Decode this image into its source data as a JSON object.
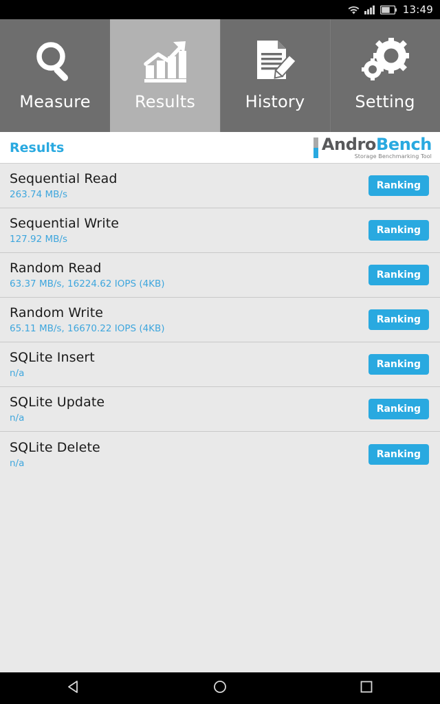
{
  "status_bar": {
    "time": "13:49",
    "icons": [
      "wifi-icon",
      "cellular-signal-icon",
      "battery-icon"
    ]
  },
  "tabs": [
    {
      "label": "Measure",
      "icon": "magnifier-icon",
      "active": false
    },
    {
      "label": "Results",
      "icon": "bar-chart-arrow-icon",
      "active": true
    },
    {
      "label": "History",
      "icon": "document-pencil-icon",
      "active": false
    },
    {
      "label": "Setting",
      "icon": "gears-icon",
      "active": false
    }
  ],
  "header": {
    "title": "Results",
    "logo_primary": "Andro",
    "logo_secondary": "Bench",
    "logo_tagline": "Storage Benchmarking Tool"
  },
  "results": [
    {
      "name": "Sequential Read",
      "value": "263.74 MB/s",
      "button": "Ranking"
    },
    {
      "name": "Sequential Write",
      "value": "127.92 MB/s",
      "button": "Ranking"
    },
    {
      "name": "Random Read",
      "value": "63.37 MB/s, 16224.62 IOPS (4KB)",
      "button": "Ranking"
    },
    {
      "name": "Random Write",
      "value": "65.11 MB/s, 16670.22 IOPS (4KB)",
      "button": "Ranking"
    },
    {
      "name": "SQLite Insert",
      "value": "n/a",
      "button": "Ranking"
    },
    {
      "name": "SQLite Update",
      "value": "n/a",
      "button": "Ranking"
    },
    {
      "name": "SQLite Delete",
      "value": "n/a",
      "button": "Ranking"
    }
  ],
  "nav_bar": {
    "back": "back-triangle-icon",
    "home": "home-circle-icon",
    "recents": "recents-square-icon"
  },
  "colors": {
    "accent_blue": "#29a9e0",
    "value_blue": "#3ea6dd",
    "tab_inactive": "#6e6e6e",
    "tab_active": "#b2b2b2",
    "list_bg": "#e9e9e9",
    "divider": "#c8c8c8"
  }
}
